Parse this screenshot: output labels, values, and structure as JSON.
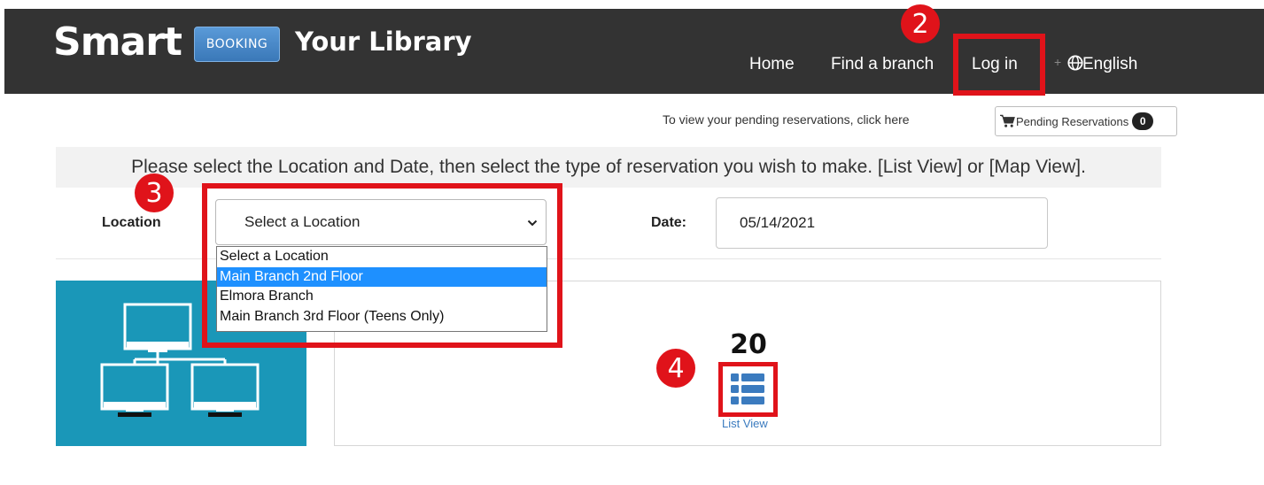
{
  "header": {
    "logo_text": "Smart",
    "logo_badge": "BOOKING",
    "title": "Your Library",
    "nav": {
      "home": "Home",
      "find_branch": "Find a branch",
      "login": "Log in",
      "plus": "+",
      "language": "English"
    }
  },
  "annotations": [
    "2",
    "3",
    "4"
  ],
  "pending": {
    "text": "To view your pending reservations, click here",
    "button_label": "Pending Reservations",
    "count": "0"
  },
  "instruction": "Please select the Location and Date, then select the type of reservation you wish to make. [List View] or [Map View].",
  "form": {
    "location_label": "Location",
    "location_selected": "Select a Location",
    "location_options": [
      "Select a Location",
      "Main Branch 2nd Floor",
      "Elmora Branch",
      "Main Branch 3rd Floor (Teens Only)"
    ],
    "highlighted_option_index": 1,
    "date_label": "Date:",
    "date_value": "05/14/2021"
  },
  "resource": {
    "count": "20",
    "list_view_label": "List View"
  },
  "colors": {
    "navbar": "#333333",
    "annotation_red": "#e0131a",
    "thumb_teal": "#1a97b8",
    "link_blue": "#3b7bbf",
    "selected_option": "#1e90ff"
  },
  "icons": [
    "globe-icon",
    "cart-icon",
    "chevron-down-icon",
    "list-view-icon",
    "computer-network-icon"
  ]
}
